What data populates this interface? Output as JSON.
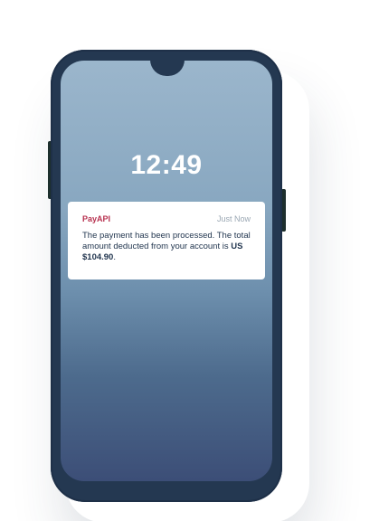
{
  "lock_screen": {
    "time": "12:49"
  },
  "notification": {
    "app_name": "PayAPI",
    "timestamp": "Just Now",
    "message_prefix": "The payment has been processed. The total amount deducted from your account is ",
    "amount": "US $104.90",
    "message_suffix": "."
  },
  "colors": {
    "app_name": "#b7314f",
    "phone_frame": "#243851",
    "screen_top": "#9bb6cc",
    "screen_bottom": "#3c4e77",
    "notification_bg": "#ffffff"
  }
}
